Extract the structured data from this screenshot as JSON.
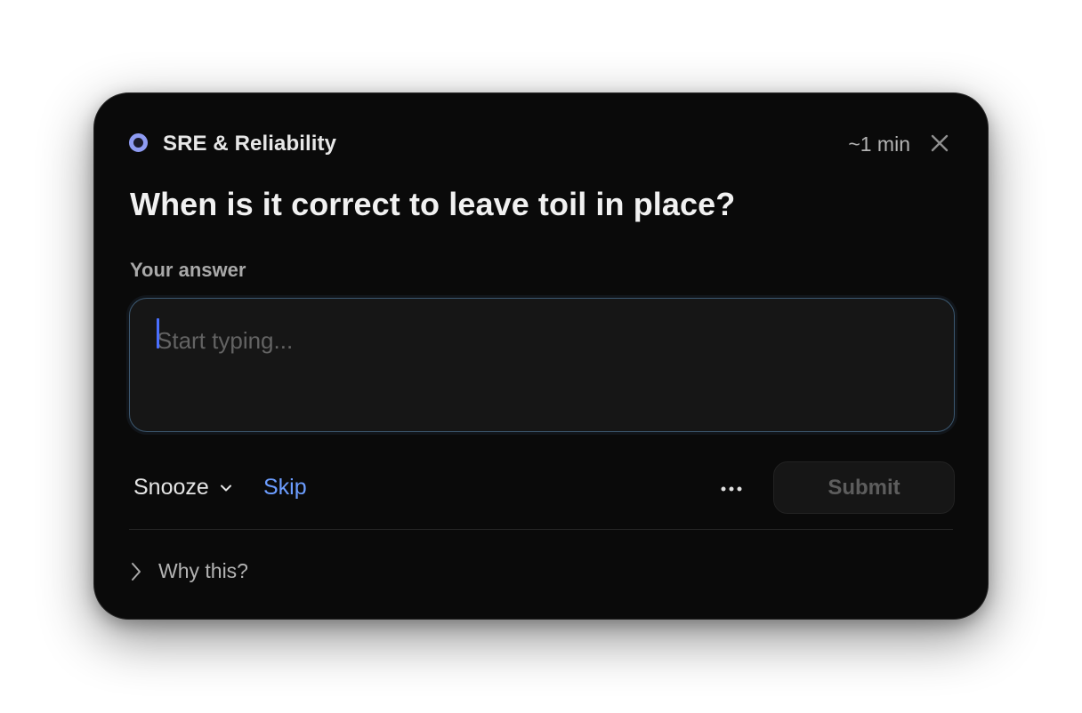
{
  "header": {
    "category": "SRE & Reliability",
    "duration": "~1 min",
    "brand_icon": "ring-dot-icon",
    "close_icon": "close-icon",
    "accent_color": "#8e9bf2"
  },
  "question": {
    "text": "When is it correct to leave toil in place?"
  },
  "answer": {
    "label": "Your answer",
    "value": "",
    "placeholder": "Start typing..."
  },
  "actions": {
    "snooze_label": "Snooze",
    "snooze_icon": "chevron-down-icon",
    "skip_label": "Skip",
    "skip_color": "#6c9dff",
    "more_icon": "more-horizontal-icon",
    "submit_label": "Submit"
  },
  "footer": {
    "why_label": "Why this?",
    "why_icon": "chevron-right-icon"
  }
}
